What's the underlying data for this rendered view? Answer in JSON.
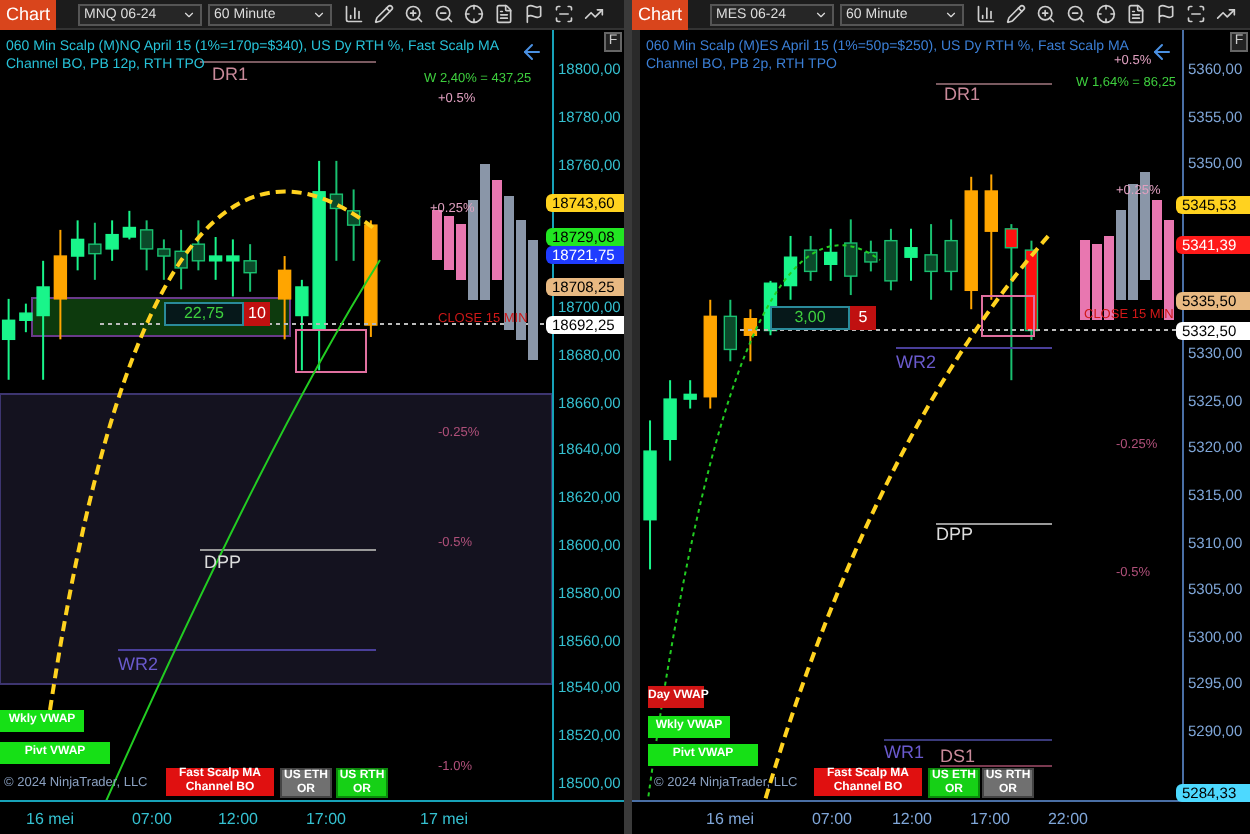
{
  "charts": [
    {
      "toolbar": {
        "tab": "Chart",
        "instrument": "MNQ 06-24",
        "interval": "60 Minute",
        "float_button": "F"
      },
      "title_lines": [
        "060 Min Scalp (M)NQ April 15 (1%=170p=$340), US Dy RTH %, Fast Scalp MA",
        "Channel BO, PB 12p, RTH TPO"
      ],
      "price_tags": [
        {
          "text": "18743,60",
          "color": "#ffd21f"
        },
        {
          "text": "18729,08",
          "color": "#22e622"
        },
        {
          "text": "18721,75",
          "color": "#1f3cff"
        },
        {
          "text": "18708,25",
          "color": "#e8b982"
        },
        {
          "text": "18692,25",
          "color": "#ffffff"
        }
      ],
      "labels": [
        {
          "text": "DR1",
          "color": "#c98a9a"
        },
        {
          "text": "W 2,40% = 437,25",
          "color": "#3ecf3e"
        },
        {
          "text": "+0.5%",
          "color": "#e0a0c0"
        },
        {
          "text": "+0.25%",
          "color": "#e0a0c0"
        },
        {
          "text": "CLOSE 15 MIN",
          "color": "#d01818"
        },
        {
          "text": "-0.25%",
          "color": "#b0507a"
        },
        {
          "text": "-0.5%",
          "color": "#b0507a"
        },
        {
          "text": "DPP",
          "color": "#dddddd"
        },
        {
          "text": "WR2",
          "color": "#6a5acd"
        },
        {
          "text": "-1.0%",
          "color": "#b0507a"
        }
      ],
      "chart_data": {
        "type": "candlestick",
        "categories": [
          null,
          null,
          null,
          null,
          null,
          null,
          null,
          null,
          null,
          null,
          null,
          null,
          null,
          null,
          null,
          null,
          null,
          null,
          null,
          null,
          null,
          null,
          null,
          null,
          null,
          null,
          null,
          null,
          null,
          null,
          null,
          null
        ],
        "ylim": [
          18492.4,
          18816
        ],
        "yticks": [
          {
            "value": 18800,
            "label": "18800,00"
          },
          {
            "value": 18780,
            "label": "18780,00"
          },
          {
            "value": 18760,
            "label": "18760,00"
          },
          {
            "value": 18700,
            "label": "18700,00"
          },
          {
            "value": 18680,
            "label": "18680,00"
          },
          {
            "value": 18660,
            "label": "18660,00"
          },
          {
            "value": 18640,
            "label": "18640,00"
          },
          {
            "value": 18620,
            "label": "18620,00"
          },
          {
            "value": 18600,
            "label": "18600,00"
          },
          {
            "value": 18580,
            "label": "18580,00"
          },
          {
            "value": 18560,
            "label": "18560,00"
          },
          {
            "value": 18540,
            "label": "18540,00"
          },
          {
            "value": 18520,
            "label": "18520,00"
          },
          {
            "value": 18500,
            "label": "18500,00"
          }
        ],
        "ohlc": [
          [
            18686,
            18703,
            18669,
            18694
          ],
          [
            18694,
            18701,
            18689,
            18697
          ],
          [
            18696,
            18719,
            18669,
            18708
          ],
          [
            18703,
            18732,
            18686,
            18721
          ],
          [
            18721,
            18736,
            18715,
            18728
          ],
          [
            18726,
            18735,
            18711,
            18722
          ],
          [
            18724,
            18736,
            18719,
            18730
          ],
          [
            18729,
            18740,
            18728,
            18733
          ],
          [
            18732,
            18736,
            18715,
            18724
          ],
          [
            18724,
            18728,
            18711,
            18721
          ],
          [
            18723,
            18732,
            18707,
            18716
          ],
          [
            18726,
            18736,
            18715,
            18719
          ],
          [
            18719,
            18729,
            18711,
            18721
          ],
          [
            18719,
            18728,
            18704,
            18721
          ],
          [
            18719,
            18726,
            18706,
            18714
          ],
          null,
          [
            18703,
            18721,
            18686,
            18715
          ],
          [
            18696,
            18711,
            18673,
            18708
          ],
          [
            18690,
            18761,
            18673,
            18748
          ],
          [
            18747,
            18761,
            18719,
            18741
          ],
          [
            18740,
            18749,
            18719,
            18734
          ],
          [
            18692,
            18736,
            18687,
            18734
          ],
          null,
          null,
          null,
          null,
          null,
          null,
          null,
          null,
          null,
          null
        ],
        "colors": [
          "#19f58a",
          "#19f58a",
          "#19f58a",
          "#ffa500",
          "#19f58a",
          "#0b4a2a",
          "#19f58a",
          "#19f58a",
          "#0b4a2a",
          "#0b4a2a",
          "#0b4a2a",
          "#0b4a2a",
          "#19f58a",
          "#19f58a",
          "#0b4a2a",
          null,
          "#ffa500",
          "#19f58a",
          "#19f58a",
          "#0b4a2a",
          "#0b4a2a",
          "#ffa500",
          null,
          null,
          null,
          null,
          null,
          null,
          null,
          null,
          null,
          null
        ]
      },
      "signal_box": {
        "value": "22,75",
        "count": "10"
      },
      "vwap_buttons": [
        {
          "label": "Wkly VWAP",
          "color": "#16e016"
        },
        {
          "label": "Pivt VWAP",
          "color": "#16e016"
        }
      ],
      "copyright": "© 2024 NinjaTrader, LLC",
      "strategy_badge": "Fast Scalp MA Channel BO",
      "session_badges": [
        {
          "label": "US ETH OR",
          "on": false
        },
        {
          "label": "US RTH OR",
          "on": true
        }
      ],
      "time_axis": [
        "16 mei",
        "07:00",
        "12:00",
        "17:00",
        "17 mei"
      ]
    },
    {
      "toolbar": {
        "tab": "Chart",
        "instrument": "MES 06-24",
        "interval": "60 Minute",
        "float_button": "F"
      },
      "title_lines": [
        "060 Min Scalp (M)ES April 15 (1%=50p=$250), US Dy RTH %, Fast Scalp MA",
        "Channel BO, PB 2p, RTH TPO"
      ],
      "price_tags": [
        {
          "text": "5345,53",
          "color": "#ffd21f"
        },
        {
          "text": "5341,39",
          "color": "#ff1a1a"
        },
        {
          "text": "5335,50",
          "color": "#e8b982"
        },
        {
          "text": "5332,50",
          "color": "#ffffff"
        },
        {
          "text": "5284,33",
          "color": "#4dd9ff"
        }
      ],
      "labels": [
        {
          "text": "+0.5%",
          "color": "#e0a0c0"
        },
        {
          "text": "DR1",
          "color": "#c98a9a"
        },
        {
          "text": "W 1,64% = 86,25",
          "color": "#3ecf3e"
        },
        {
          "text": "+0.25%",
          "color": "#e0a0c0"
        },
        {
          "text": "CLOSE 15 MIN",
          "color": "#d01818"
        },
        {
          "text": "WR2",
          "color": "#6a5acd"
        },
        {
          "text": "-0.25%",
          "color": "#b0507a"
        },
        {
          "text": "DPP",
          "color": "#dddddd"
        },
        {
          "text": "-0.5%",
          "color": "#b0507a"
        },
        {
          "text": "WR1",
          "color": "#6a5acd"
        },
        {
          "text": "DS1",
          "color": "#c98a9a"
        }
      ],
      "chart_data": {
        "type": "candlestick",
        "categories": [
          null,
          null,
          null,
          null,
          null,
          null,
          null,
          null,
          null,
          null,
          null,
          null,
          null,
          null,
          null,
          null,
          null,
          null,
          null,
          null,
          null,
          null,
          null,
          null,
          null,
          null,
          null
        ],
        "ylim": [
          5282.62,
          5364.02
        ],
        "yticks": [
          {
            "value": 5360,
            "label": "5360,00"
          },
          {
            "value": 5355,
            "label": "5355,00"
          },
          {
            "value": 5350,
            "label": "5350,00"
          },
          {
            "value": 5330,
            "label": "5330,00"
          },
          {
            "value": 5325,
            "label": "5325,00"
          },
          {
            "value": 5320,
            "label": "5320,00"
          },
          {
            "value": 5315,
            "label": "5315,00"
          },
          {
            "value": 5310,
            "label": "5310,00"
          },
          {
            "value": 5305,
            "label": "5305,00"
          },
          {
            "value": 5300,
            "label": "5300,00"
          },
          {
            "value": 5295,
            "label": "5295,00"
          },
          {
            "value": 5290,
            "label": "5290,00"
          }
        ],
        "ohlc": [
          [
            5312.25,
            5322.75,
            5307,
            5319.5
          ],
          [
            5320.75,
            5327,
            5318.5,
            5325
          ],
          [
            5325,
            5327,
            5324,
            5325.5
          ],
          [
            5325.25,
            5335.5,
            5324,
            5333.75
          ],
          [
            5333.75,
            5335.5,
            5329,
            5330.25
          ],
          [
            5331.75,
            5334.5,
            5329,
            5333.5
          ],
          [
            5332.25,
            5337.5,
            5331.75,
            5337.25
          ],
          [
            5337,
            5342.25,
            5335.5,
            5340
          ],
          [
            5340.75,
            5342.25,
            5337.5,
            5338.5
          ],
          [
            5339.25,
            5343,
            5337.5,
            5340.5
          ],
          [
            5341.5,
            5344,
            5336,
            5338
          ],
          [
            5340.5,
            5341.75,
            5338.5,
            5339.5
          ],
          [
            5341.75,
            5343,
            5336.5,
            5337.5
          ],
          [
            5340,
            5343,
            5337.5,
            5341
          ],
          [
            5340.25,
            5343.5,
            5335.5,
            5338.5
          ],
          [
            5341.75,
            5344,
            5336.5,
            5338.5
          ],
          [
            5336.5,
            5348.5,
            5334.5,
            5347
          ],
          [
            5342.75,
            5348.75,
            5335.5,
            5347
          ],
          [
            5343,
            5343.5,
            5327,
            5341
          ],
          [
            5340.75,
            5341.75,
            5331.25,
            5332.25
          ],
          null,
          null,
          null,
          null,
          null,
          null,
          null
        ],
        "colors": [
          "#19f58a",
          "#19f58a",
          "#19f58a",
          "#ffa500",
          "#0b4a2a",
          "#ffa500",
          "#19f58a",
          "#19f58a",
          "#0b4a2a",
          "#19f58a",
          "#0b4a2a",
          "#0b4a2a",
          "#0b4a2a",
          "#19f58a",
          "#0b4a2a",
          "#0b4a2a",
          "#ffa500",
          "#ffa500",
          "#ff1010",
          "#ff1010",
          null,
          null,
          null,
          null,
          null,
          null,
          null
        ]
      },
      "signal_box": {
        "value": "3,00",
        "count": "5"
      },
      "vwap_buttons": [
        {
          "label": "Day VWAP",
          "color": "#d01414"
        },
        {
          "label": "Wkly VWAP",
          "color": "#16e016"
        },
        {
          "label": "Pivt VWAP",
          "color": "#16e016"
        }
      ],
      "copyright": "© 2024 NinjaTrader, LLC",
      "strategy_badge": "Fast Scalp MA Channel BO",
      "session_badges": [
        {
          "label": "US ETH OR",
          "on": true
        },
        {
          "label": "US RTH OR",
          "on": false
        }
      ],
      "time_axis": [
        "16 mei",
        "07:00",
        "12:00",
        "17:00",
        "22:00"
      ]
    }
  ]
}
